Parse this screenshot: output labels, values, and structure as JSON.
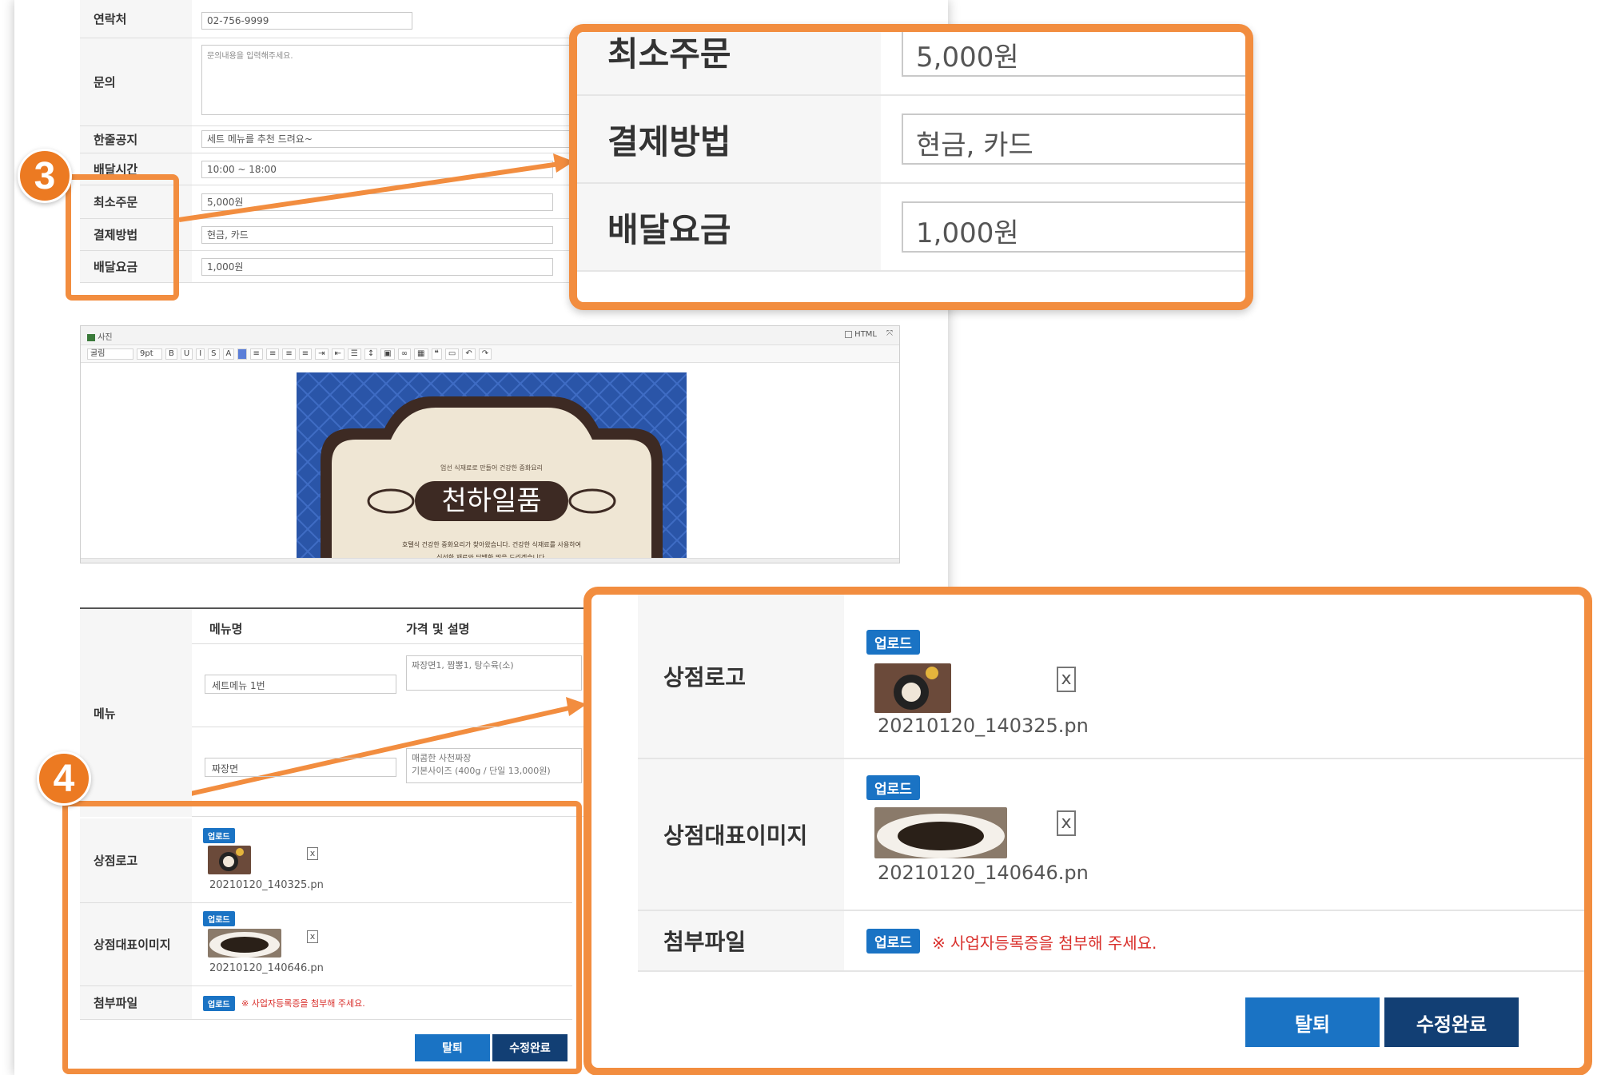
{
  "form": {
    "contact": {
      "label": "연락처",
      "value": "02-756-9999"
    },
    "inquiry": {
      "label": "문의",
      "placeholder": "문의내용을 입력해주세요."
    },
    "notice": {
      "label": "한줄공지",
      "value": "세트 메뉴를 추천 드려요~"
    },
    "delivery_time": {
      "label": "배달시간",
      "value": "10:00 ~ 18:00"
    },
    "min_order": {
      "label": "최소주문",
      "value": "5,000원"
    },
    "payment": {
      "label": "결제방법",
      "value": "현금, 카드"
    },
    "delivery_fee": {
      "label": "배달요금",
      "value": "1,000원"
    }
  },
  "editor": {
    "title": "사진",
    "html_label": "HTML",
    "font": "굴림",
    "size": "9pt",
    "poster_title": "천하일품",
    "poster_top": "엄선 식재료로 만들어 건강한 중화요리",
    "poster_line1": "호텔식 건강한 중화요리가 찾아왔습니다. 건강한 식재료를 사용하여",
    "poster_line2": "신선한 재료와 담백한 맛을 드리겠습니다."
  },
  "menu": {
    "label": "메뉴",
    "col_name": "메뉴명",
    "col_desc": "가격 및 설명",
    "items": [
      {
        "name": "세트메뉴 1번",
        "desc": "짜장면1, 짬뽕1, 탕수육(소)",
        "desc2": ""
      },
      {
        "name": "짜장면",
        "desc": "매콤한 사천짜장",
        "desc2": "기본사이즈 (400g / 단일 13,000원)"
      }
    ]
  },
  "uploads": {
    "upload_label": "업로드",
    "logo": {
      "label": "상점로고",
      "file": "20210120_140325.pn"
    },
    "rep_image": {
      "label": "상점대표이미지",
      "file": "20210120_140646.pn"
    },
    "attachment": {
      "label": "첨부파일",
      "warning": "※ 사업자등록증을 첨부해 주세요."
    },
    "x_mark": "x"
  },
  "buttons": {
    "quit": "탈퇴",
    "done": "수정완료"
  },
  "badges": {
    "step3": "3",
    "step4": "4"
  },
  "colors": {
    "accent_orange": "#f28d3f",
    "upload_blue": "#1a73c4",
    "done_navy": "#123f74",
    "warning_red": "#d9302c"
  }
}
